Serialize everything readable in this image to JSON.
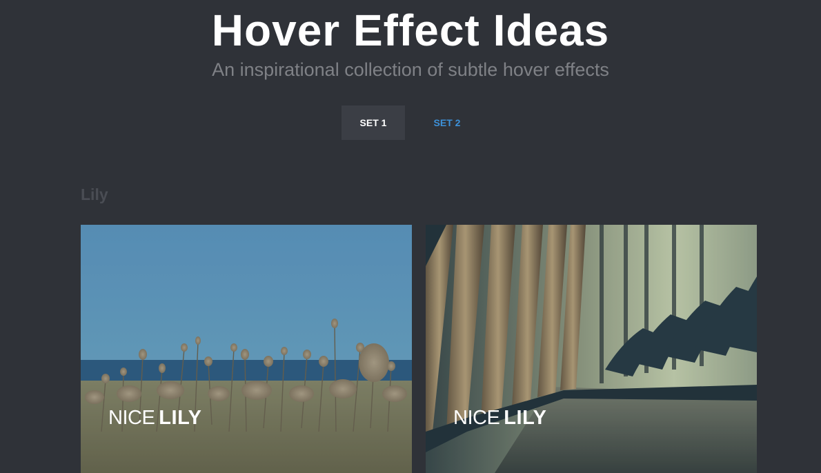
{
  "header": {
    "title": "Hover Effect Ideas",
    "subtitle": "An inspirational collection of subtle hover effects"
  },
  "nav": {
    "items": [
      {
        "label": "SET 1",
        "active": true
      },
      {
        "label": "SET 2",
        "active": false
      }
    ],
    "active_bg": "#3b3e45",
    "link_color": "#3d91d9"
  },
  "section": {
    "title": "Lily"
  },
  "cards": [
    {
      "caption_light": "NICE",
      "caption_bold": "LILY",
      "image": "field-flowers-sea-photo"
    },
    {
      "caption_light": "NICE",
      "caption_bold": "LILY",
      "image": "auditorium-seats-photo"
    }
  ],
  "colors": {
    "background": "#2f3238",
    "title": "#ffffff",
    "subtitle": "#7f8186",
    "section_title": "#4a4d54"
  }
}
